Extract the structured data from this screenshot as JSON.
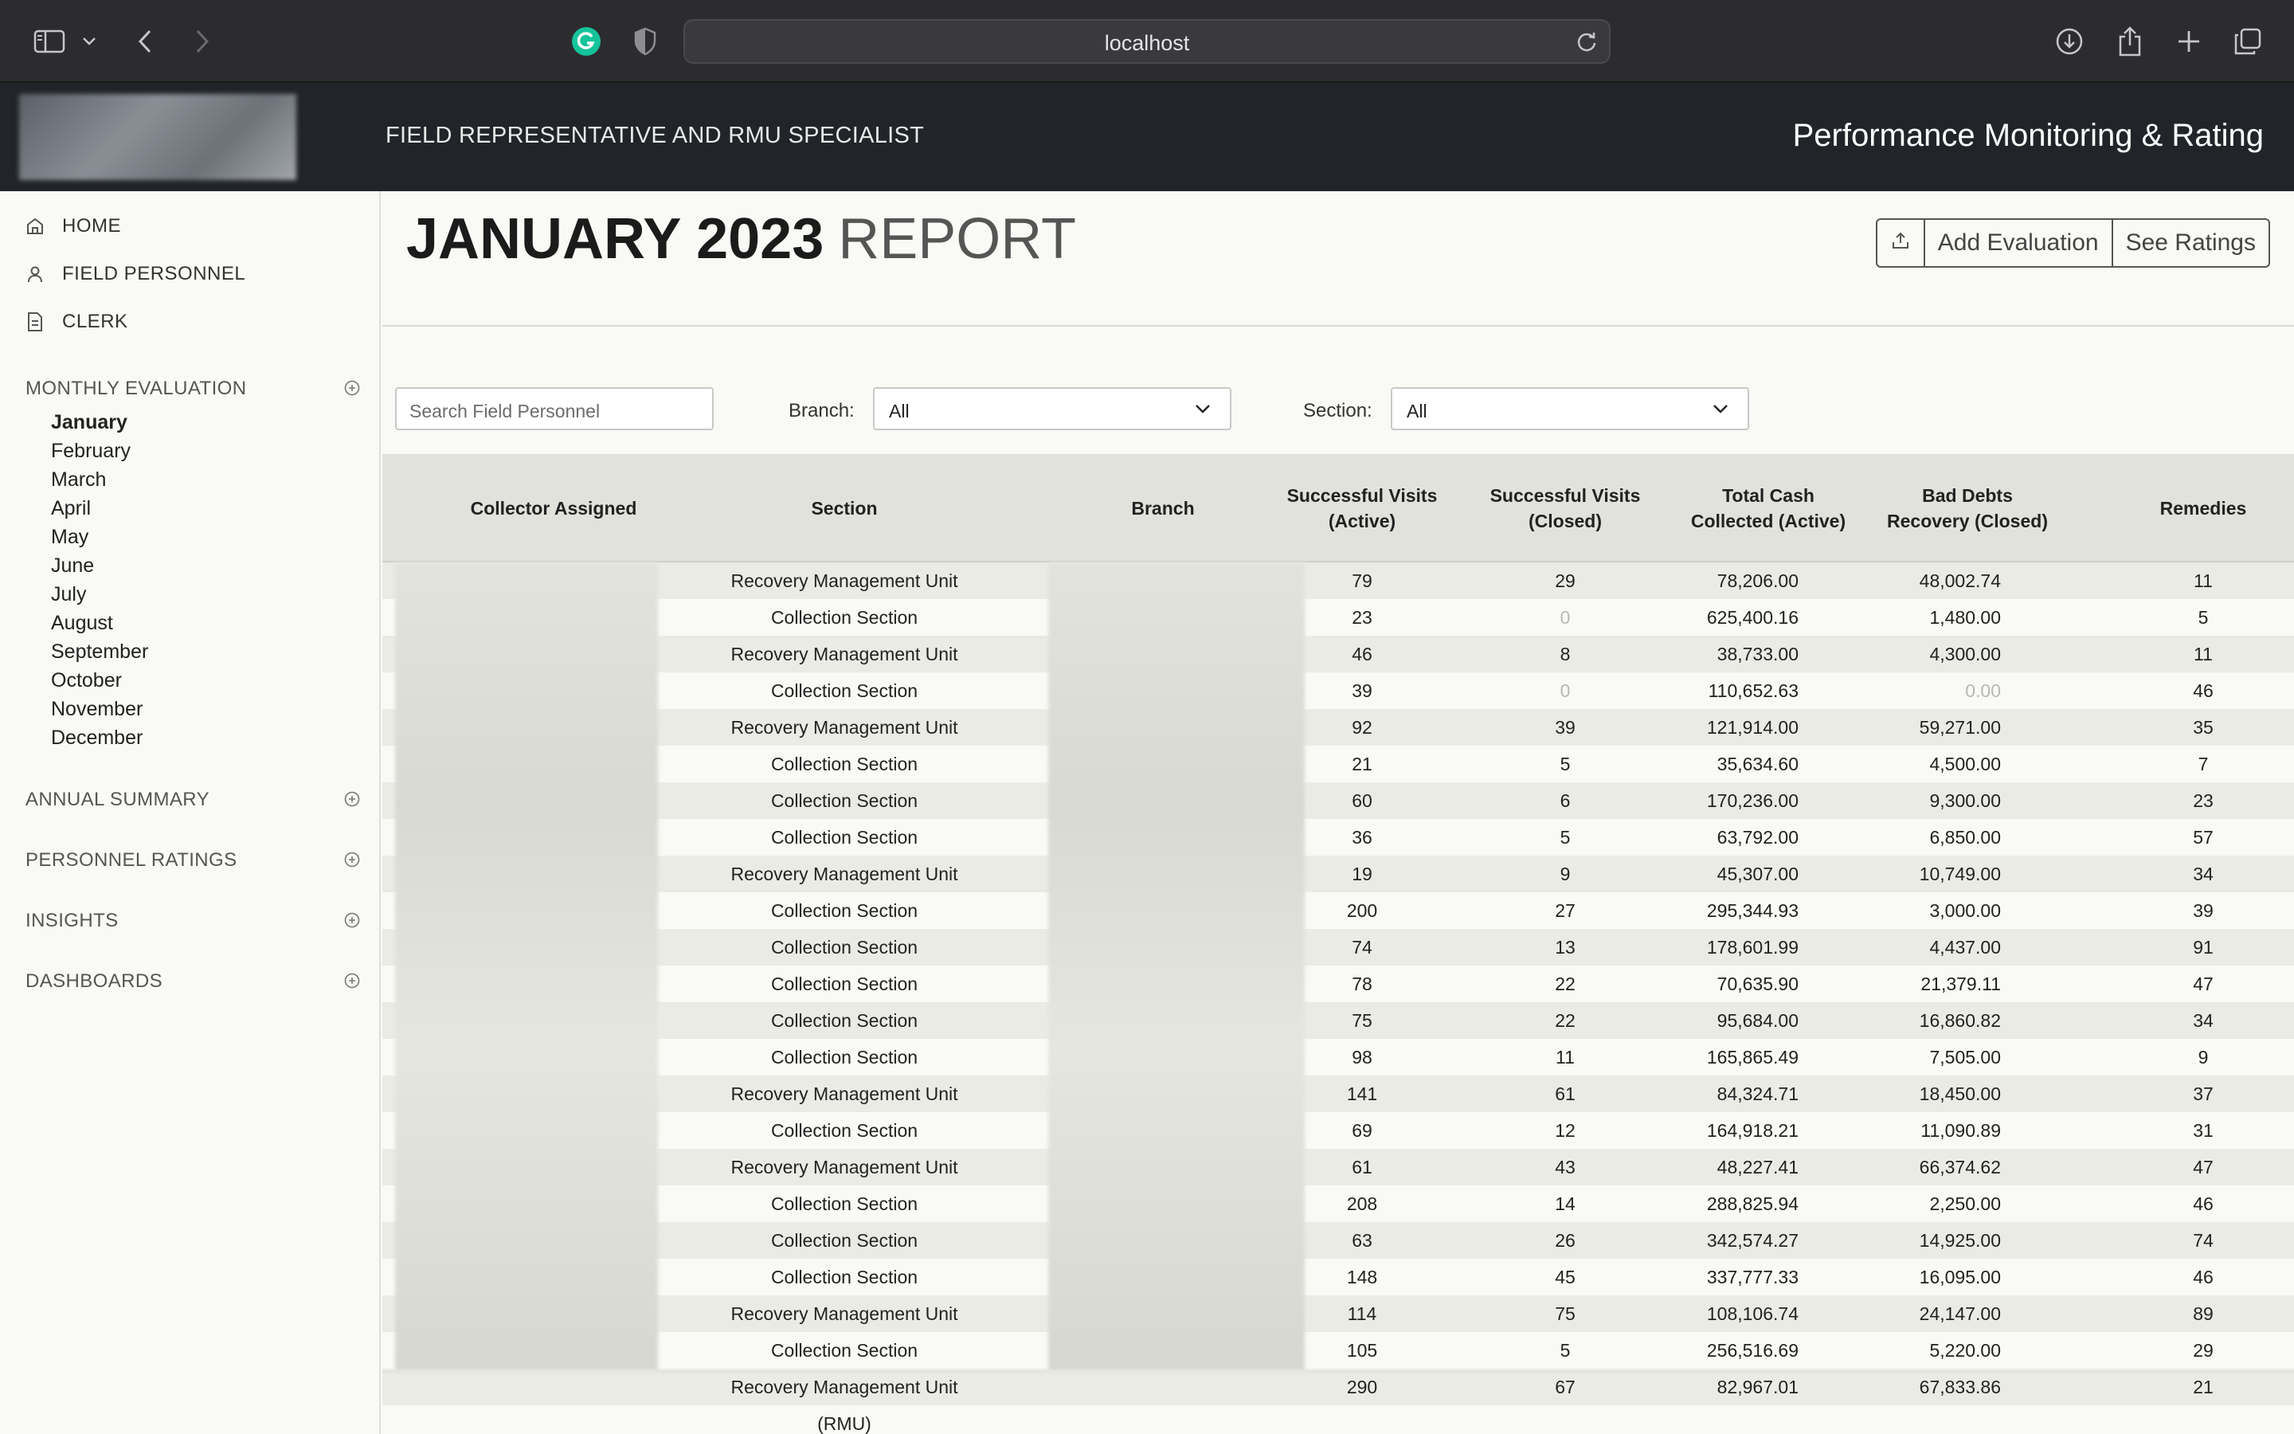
{
  "browser": {
    "url": "localhost",
    "icons": [
      "sidebar-toggle-icon",
      "chevron-down-icon",
      "back-arrow-icon",
      "forward-arrow-icon",
      "grammarly-icon",
      "shield-icon",
      "reload-icon",
      "download-icon",
      "share-icon",
      "new-tab-icon",
      "tabs-overview-icon"
    ]
  },
  "header": {
    "subtitle": "FIELD REPRESENTATIVE AND RMU SPECIALIST",
    "title": "Performance Monitoring & Rating"
  },
  "sidebar": {
    "nav": [
      {
        "label": "HOME",
        "icon": "home-icon"
      },
      {
        "label": "FIELD PERSONNEL",
        "icon": "person-icon"
      },
      {
        "label": "CLERK",
        "icon": "document-icon"
      }
    ],
    "monthly_evaluation": "MONTHLY EVALUATION",
    "months": [
      "January",
      "February",
      "March",
      "April",
      "May",
      "June",
      "July",
      "August",
      "September",
      "October",
      "November",
      "December"
    ],
    "active_month": "January",
    "sections": [
      "ANNUAL SUMMARY",
      "PERSONNEL RATINGS",
      "INSIGHTS",
      "DASHBOARDS"
    ]
  },
  "report": {
    "title_bold": "JANUARY 2023",
    "title_light": "REPORT",
    "add_evaluation": "Add Evaluation",
    "see_ratings": "See Ratings"
  },
  "filters": {
    "search_placeholder": "Search Field Personnel",
    "branch_label": "Branch:",
    "branch_value": "All",
    "section_label": "Section:",
    "section_value": "All"
  },
  "table": {
    "headers": {
      "collector": "Collector Assigned",
      "section": "Section",
      "branch": "Branch",
      "visits_active_1": "Successful Visits",
      "visits_active_2": "(Active)",
      "visits_closed_1": "Successful Visits",
      "visits_closed_2": "(Closed)",
      "cash_1": "Total Cash",
      "cash_2": "Collected (Active)",
      "bad_1": "Bad Debts",
      "bad_2": "Recovery (Closed)",
      "remedies": "Remedies"
    },
    "rows": [
      [
        "Recovery Management Unit (RMU)",
        "79",
        "29",
        "78,206.00",
        "48,002.74",
        "11"
      ],
      [
        "Collection Section",
        "23",
        "0",
        "625,400.16",
        "1,480.00",
        "5"
      ],
      [
        "Recovery Management Unit (RMU)",
        "46",
        "8",
        "38,733.00",
        "4,300.00",
        "11"
      ],
      [
        "Collection Section",
        "39",
        "0",
        "110,652.63",
        "0.00",
        "46"
      ],
      [
        "Recovery Management Unit (RMU)",
        "92",
        "39",
        "121,914.00",
        "59,271.00",
        "35"
      ],
      [
        "Collection Section",
        "21",
        "5",
        "35,634.60",
        "4,500.00",
        "7"
      ],
      [
        "Collection Section",
        "60",
        "6",
        "170,236.00",
        "9,300.00",
        "23"
      ],
      [
        "Collection Section",
        "36",
        "5",
        "63,792.00",
        "6,850.00",
        "57"
      ],
      [
        "Recovery Management Unit (RMU)",
        "19",
        "9",
        "45,307.00",
        "10,749.00",
        "34"
      ],
      [
        "Collection Section",
        "200",
        "27",
        "295,344.93",
        "3,000.00",
        "39"
      ],
      [
        "Collection Section",
        "74",
        "13",
        "178,601.99",
        "4,437.00",
        "91"
      ],
      [
        "Collection Section",
        "78",
        "22",
        "70,635.90",
        "21,379.11",
        "47"
      ],
      [
        "Collection Section",
        "75",
        "22",
        "95,684.00",
        "16,860.82",
        "34"
      ],
      [
        "Collection Section",
        "98",
        "11",
        "165,865.49",
        "7,505.00",
        "9"
      ],
      [
        "Recovery Management Unit (RMU)",
        "141",
        "61",
        "84,324.71",
        "18,450.00",
        "37"
      ],
      [
        "Collection Section",
        "69",
        "12",
        "164,918.21",
        "11,090.89",
        "31"
      ],
      [
        "Recovery Management Unit (RMU)",
        "61",
        "43",
        "48,227.41",
        "66,374.62",
        "47"
      ],
      [
        "Collection Section",
        "208",
        "14",
        "288,825.94",
        "2,250.00",
        "46"
      ],
      [
        "Collection Section",
        "63",
        "26",
        "342,574.27",
        "14,925.00",
        "74"
      ],
      [
        "Collection Section",
        "148",
        "45",
        "337,777.33",
        "16,095.00",
        "46"
      ],
      [
        "Recovery Management Unit (RMU)",
        "114",
        "75",
        "108,106.74",
        "24,147.00",
        "89"
      ],
      [
        "Collection Section",
        "105",
        "5",
        "256,516.69",
        "5,220.00",
        "29"
      ],
      [
        "Recovery Management Unit (RMU)",
        "290",
        "67",
        "82,967.01",
        "67,833.86",
        "21"
      ]
    ]
  }
}
